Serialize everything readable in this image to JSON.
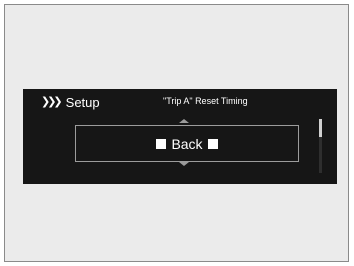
{
  "screen": {
    "menu_label": "Setup",
    "chevron_icon": "triple-chevron-right-icon",
    "title": "\"Trip A\" Reset Timing",
    "item": {
      "label": "Back",
      "left_marker": "white-square",
      "right_marker": "white-square"
    },
    "arrows": {
      "up": "triangle-up-icon",
      "down": "triangle-down-icon"
    },
    "scroll_position": 0
  },
  "colors": {
    "screen_background": "#161616",
    "frame_background": "#ebebeb",
    "text": "#ffffff",
    "border": "#9c9c9c"
  }
}
